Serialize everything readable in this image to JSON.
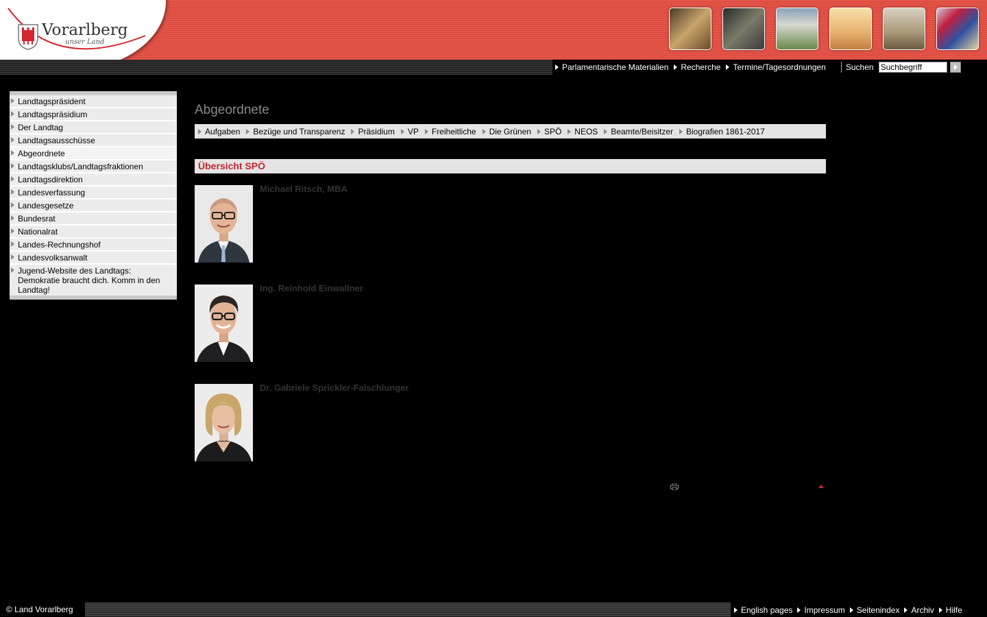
{
  "header": {
    "logo_text": "Vorarlberg",
    "logo_subtitle": "unser Land",
    "thumbnails": [
      "rathaus-bell-photo",
      "laptop-photo",
      "landhaus-building-photo",
      "hall-interior-photo",
      "plenary-chamber-photo",
      "artwork-photo"
    ]
  },
  "topnav": {
    "links": [
      "Parlamentarische Materialien",
      "Recherche",
      "Termine/Tagesordnungen"
    ],
    "search_label": "Suchen",
    "search_value": "Suchbegriff"
  },
  "sidebar": {
    "items": [
      {
        "label": "Landtagspräsident"
      },
      {
        "label": "Landtagspräsidium"
      },
      {
        "label": "Der Landtag"
      },
      {
        "label": "Landtagsausschüsse"
      },
      {
        "label": "Abgeordnete",
        "active": true
      },
      {
        "label": "Landtagsklubs/Landtagsfraktionen"
      },
      {
        "label": "Landtagsdirektion"
      },
      {
        "label": "Landesverfassung"
      },
      {
        "label": "Landesgesetze"
      },
      {
        "label": "Bundesrat"
      },
      {
        "label": "Nationalrat"
      },
      {
        "label": "Landes-Rechnungshof"
      },
      {
        "label": "Landesvolksanwalt"
      },
      {
        "label": "Jugend-Website des Landtags: Demokratie braucht dich. Komm in den Landtag!"
      }
    ]
  },
  "main": {
    "title": "Abgeordnete",
    "subnav": [
      "Aufgaben",
      "Bezüge und Transparenz",
      "Präsidium",
      "VP",
      "Freiheitliche",
      "Die Grünen",
      "SPÖ",
      "NEOS",
      "Beamte/Beisitzer",
      "Biografien 1861-2017"
    ],
    "section_title": "Übersicht SPÖ",
    "people": [
      {
        "name": "Michael Ritsch, MBA"
      },
      {
        "name": "Ing. Reinhold Einwallner"
      },
      {
        "name": "Dr. Gabriele Sprickler-Falschlunger"
      }
    ]
  },
  "footer": {
    "copyright": "© Land Vorarlberg",
    "links": [
      "English pages",
      "Impressum",
      "Seitenindex",
      "Archiv",
      "Hilfe"
    ]
  },
  "colors": {
    "brand_red": "#e3574a",
    "accent_red": "#c4262e",
    "panel_grey": "#e4e4e4"
  }
}
